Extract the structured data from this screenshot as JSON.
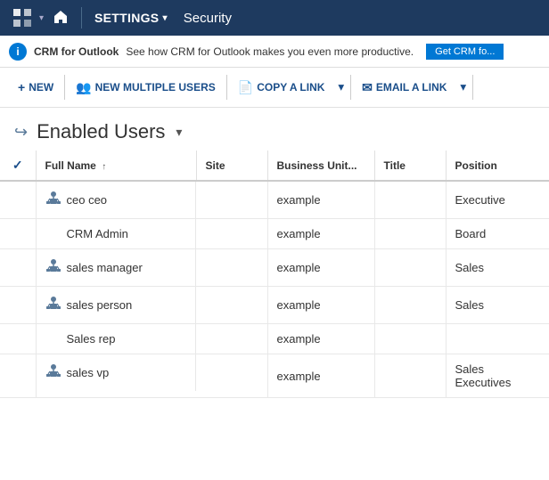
{
  "nav": {
    "settings_label": "SETTINGS",
    "title": "Security"
  },
  "banner": {
    "icon": "i",
    "label": "CRM for Outlook",
    "text": "See how CRM for Outlook makes you even more productive.",
    "button": "Get CRM fo..."
  },
  "toolbar": {
    "new_label": "NEW",
    "new_multiple_label": "NEW MULTIPLE USERS",
    "copy_label": "COPY A LINK",
    "email_label": "EMAIL A LINK"
  },
  "page": {
    "title": "Enabled Users",
    "icon": "→"
  },
  "table": {
    "columns": [
      {
        "key": "check",
        "label": "✓"
      },
      {
        "key": "fullname",
        "label": "Full Name ↑"
      },
      {
        "key": "site",
        "label": "Site"
      },
      {
        "key": "business_unit",
        "label": "Business Unit..."
      },
      {
        "key": "title",
        "label": "Title"
      },
      {
        "key": "position",
        "label": "Position"
      }
    ],
    "rows": [
      {
        "icon": true,
        "fullname": "ceo ceo",
        "site": "",
        "business_unit": "example",
        "title": "",
        "position": "Executive"
      },
      {
        "icon": false,
        "fullname": "CRM Admin",
        "site": "",
        "business_unit": "example",
        "title": "",
        "position": "Board"
      },
      {
        "icon": true,
        "fullname": "sales manager",
        "site": "",
        "business_unit": "example",
        "title": "",
        "position": "Sales"
      },
      {
        "icon": true,
        "fullname": "sales person",
        "site": "",
        "business_unit": "example",
        "title": "",
        "position": "Sales"
      },
      {
        "icon": false,
        "fullname": "Sales rep",
        "site": "",
        "business_unit": "example",
        "title": "",
        "position": ""
      },
      {
        "icon": true,
        "fullname": "sales vp",
        "site": "",
        "business_unit": "example",
        "title": "",
        "position": "Sales Executives"
      }
    ]
  }
}
